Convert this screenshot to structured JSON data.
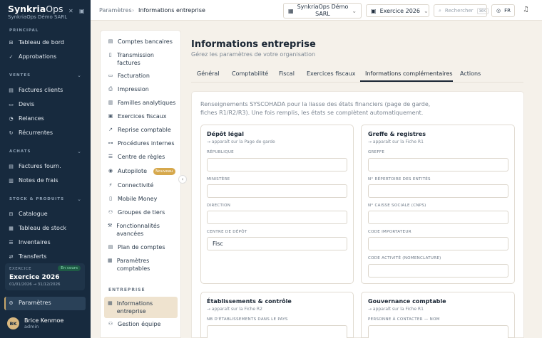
{
  "app": {
    "name": "Synkria",
    "name_suffix": "Ops",
    "org": "SynkriaOps Démo SARL"
  },
  "sidebar": {
    "principal_title": "PRINCIPAL",
    "principal": [
      {
        "label": "Tableau de bord"
      },
      {
        "label": "Approbations"
      }
    ],
    "ventes_title": "VENTES",
    "ventes": [
      {
        "label": "Factures clients"
      },
      {
        "label": "Devis"
      },
      {
        "label": "Relances"
      },
      {
        "label": "Récurrentes"
      }
    ],
    "achats_title": "ACHATS",
    "achats": [
      {
        "label": "Factures fourn."
      },
      {
        "label": "Notes de frais"
      }
    ],
    "stock_title": "STOCK & PRODUITS",
    "stock": [
      {
        "label": "Catalogue"
      },
      {
        "label": "Tableau de stock"
      },
      {
        "label": "Inventaires"
      },
      {
        "label": "Transferts"
      }
    ],
    "exercise": {
      "label": "EXERCICE",
      "status": "En cours",
      "year": "Exercice 2026",
      "dates": "01/01/2026 → 31/12/2026"
    },
    "active": {
      "label": "Paramètres"
    },
    "user": {
      "initials": "BK",
      "name": "Brice Kenmoe",
      "role": "admin"
    }
  },
  "topbar": {
    "breadcrumb_root": "Paramètres",
    "breadcrumb_sep": "›",
    "breadcrumb_current": "Informations entreprise",
    "company_line1": "SynkriaOps Démo",
    "company_line2": "SARL",
    "exercise": "Exercice 2026",
    "search_placeholder": "Rechercher",
    "search_shortcut": "⌘K",
    "lang": "FR"
  },
  "settings_nav": {
    "items": [
      {
        "label": "Comptes bancaires"
      },
      {
        "label": "Transmission factures"
      },
      {
        "label": "Facturation"
      },
      {
        "label": "Impression"
      },
      {
        "label": "Familles analytiques"
      },
      {
        "label": "Exercices fiscaux"
      },
      {
        "label": "Reprise comptable"
      },
      {
        "label": "Procédures internes"
      },
      {
        "label": "Centre de règles"
      },
      {
        "label": "Autopilote",
        "badge": "Nouveau"
      },
      {
        "label": "Connectivité"
      },
      {
        "label": "Mobile Money"
      },
      {
        "label": "Groupes de tiers"
      },
      {
        "label": "Fonctionnalités avancées"
      },
      {
        "label": "Plan de comptes"
      },
      {
        "label": "Paramètres comptables"
      }
    ],
    "section_title": "ENTREPRISE",
    "entreprise": [
      {
        "label": "Informations entreprise"
      },
      {
        "label": "Gestion équipe"
      }
    ]
  },
  "main": {
    "title": "Informations entreprise",
    "subtitle": "Gérez les paramètres de votre organisation",
    "tabs": [
      {
        "label": "Général"
      },
      {
        "label": "Comptabilité"
      },
      {
        "label": "Fiscal"
      },
      {
        "label": "Exercices fiscaux"
      },
      {
        "label": "Informations complémentaires"
      },
      {
        "label": "Actions"
      }
    ],
    "intro": "Renseignements SYSCOHADA pour la liasse des états financiers (page de garde, fiches R1/R2/R3). Une fois remplis, les états se complètent automatiquement.",
    "depot": {
      "title": "Dépôt légal",
      "subtitle": "→ apparaît sur la Page de garde",
      "fields": [
        {
          "label": "RÉPUBLIQUE",
          "value": ""
        },
        {
          "label": "MINISTÈRE",
          "value": ""
        },
        {
          "label": "DIRECTION",
          "value": ""
        },
        {
          "label": "CENTRE DE DÉPÔT",
          "value": "Fisc"
        }
      ]
    },
    "greffe": {
      "title": "Greffe & registres",
      "subtitle": "→ apparaît sur la Fiche R1",
      "fields": [
        {
          "label": "GREFFE",
          "value": ""
        },
        {
          "label": "N° RÉPERTOIRE DES ENTITÉS",
          "value": ""
        },
        {
          "label": "N° CAISSE SOCIALE (CNPS)",
          "value": ""
        },
        {
          "label": "CODE IMPORTATEUR",
          "value": ""
        },
        {
          "label": "CODE ACTIVITÉ (NOMENCLATURE)",
          "value": ""
        }
      ]
    },
    "etab": {
      "title": "Établissements & contrôle",
      "subtitle": "→ apparaît sur la Fiche R2",
      "field_label": "NB D'ÉTABLISSEMENTS DANS LE PAYS"
    },
    "gouv": {
      "title": "Gouvernance comptable",
      "subtitle": "→ apparaît sur la Fiche R1",
      "field_label": "PERSONNE À CONTACTER — NOM"
    }
  }
}
